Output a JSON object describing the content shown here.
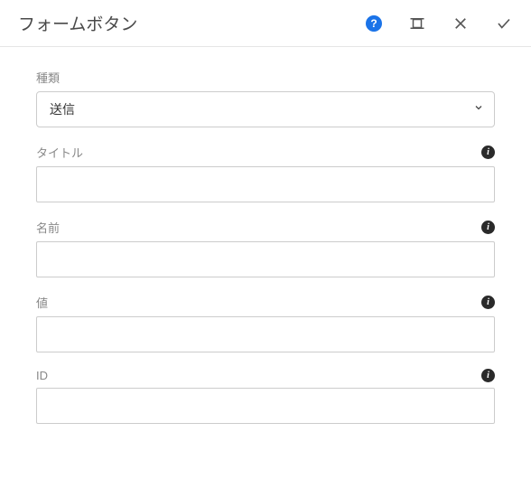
{
  "header": {
    "title": "フォームボタン"
  },
  "fields": {
    "type": {
      "label": "種類",
      "value": "送信"
    },
    "title": {
      "label": "タイトル",
      "value": ""
    },
    "name": {
      "label": "名前",
      "value": ""
    },
    "value": {
      "label": "値",
      "value": ""
    },
    "id": {
      "label": "ID",
      "value": ""
    }
  }
}
